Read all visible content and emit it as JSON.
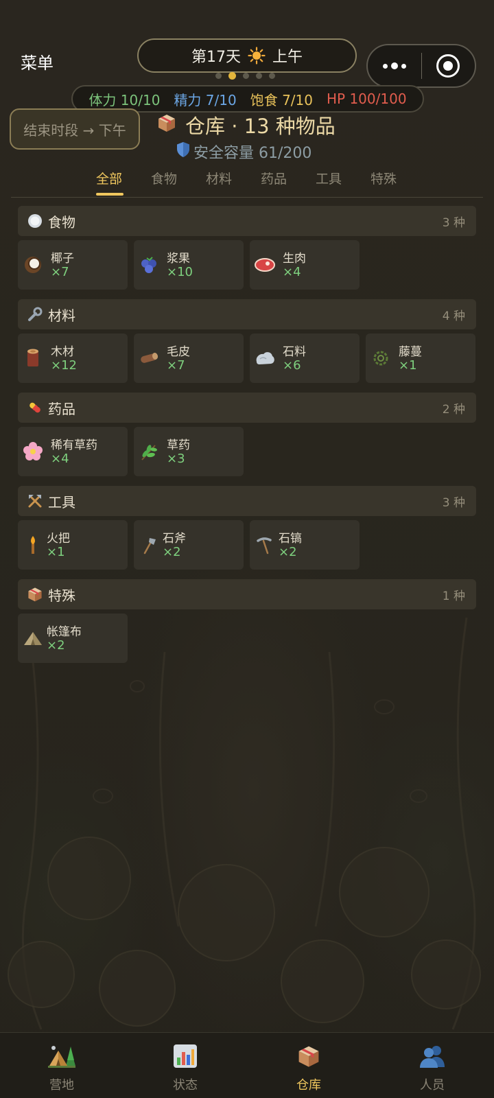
{
  "header": {
    "menu_label": "菜单",
    "day_label": "第17天",
    "period_label": "上午",
    "page_dots": 5,
    "page_dot_active": 1
  },
  "stats": {
    "stamina": "体力 10/10",
    "energy": "精力 7/10",
    "hunger": "饱食 7/10",
    "hp": "HP 100/100"
  },
  "end_period_button": "结束时段 → 下午",
  "warehouse": {
    "title": "仓库 · 13 种物品",
    "capacity": "安全容量 61/200"
  },
  "tabs": [
    {
      "label": "全部",
      "active": true
    },
    {
      "label": "食物",
      "active": false
    },
    {
      "label": "材料",
      "active": false
    },
    {
      "label": "药品",
      "active": false
    },
    {
      "label": "工具",
      "active": false
    },
    {
      "label": "特殊",
      "active": false
    }
  ],
  "sections": [
    {
      "title": "食物",
      "icon": "plate-icon",
      "count": "3 种",
      "items": [
        {
          "name": "椰子",
          "qty": "×7",
          "icon": "coconut-icon"
        },
        {
          "name": "浆果",
          "qty": "×10",
          "icon": "berries-icon"
        },
        {
          "name": "生肉",
          "qty": "×4",
          "icon": "raw-meat-icon"
        }
      ]
    },
    {
      "title": "材料",
      "icon": "wrench-icon",
      "count": "4 种",
      "items": [
        {
          "name": "木材",
          "qty": "×12",
          "icon": "wood-icon"
        },
        {
          "name": "毛皮",
          "qty": "×7",
          "icon": "fur-icon"
        },
        {
          "name": "石料",
          "qty": "×6",
          "icon": "stone-icon"
        },
        {
          "name": "藤蔓",
          "qty": "×1",
          "icon": "vine-icon"
        }
      ]
    },
    {
      "title": "药品",
      "icon": "pill-icon",
      "count": "2 种",
      "items": [
        {
          "name": "稀有草药",
          "qty": "×4",
          "icon": "flower-icon"
        },
        {
          "name": "草药",
          "qty": "×3",
          "icon": "herb-icon"
        }
      ]
    },
    {
      "title": "工具",
      "icon": "tools-icon",
      "count": "3 种",
      "items": [
        {
          "name": "火把",
          "qty": "×1",
          "icon": "torch-icon"
        },
        {
          "name": "石斧",
          "qty": "×2",
          "icon": "axe-icon"
        },
        {
          "name": "石镐",
          "qty": "×2",
          "icon": "pickaxe-icon"
        }
      ]
    },
    {
      "title": "特殊",
      "icon": "box-icon",
      "count": "1 种",
      "items": [
        {
          "name": "帐篷布",
          "qty": "×2",
          "icon": "tent-cloth-icon"
        }
      ]
    }
  ],
  "bottom_nav": [
    {
      "label": "营地",
      "icon": "camp-icon",
      "active": false
    },
    {
      "label": "状态",
      "icon": "chart-icon",
      "active": false
    },
    {
      "label": "仓库",
      "icon": "package-icon",
      "active": true
    },
    {
      "label": "人员",
      "icon": "people-icon",
      "active": false
    }
  ],
  "colors": {
    "accent": "#f0c75e",
    "qty_green": "#7ed07e",
    "stamina": "#7cc47c",
    "energy": "#6ca7e6",
    "hunger": "#e9c25a",
    "hp": "#e25d4e"
  }
}
